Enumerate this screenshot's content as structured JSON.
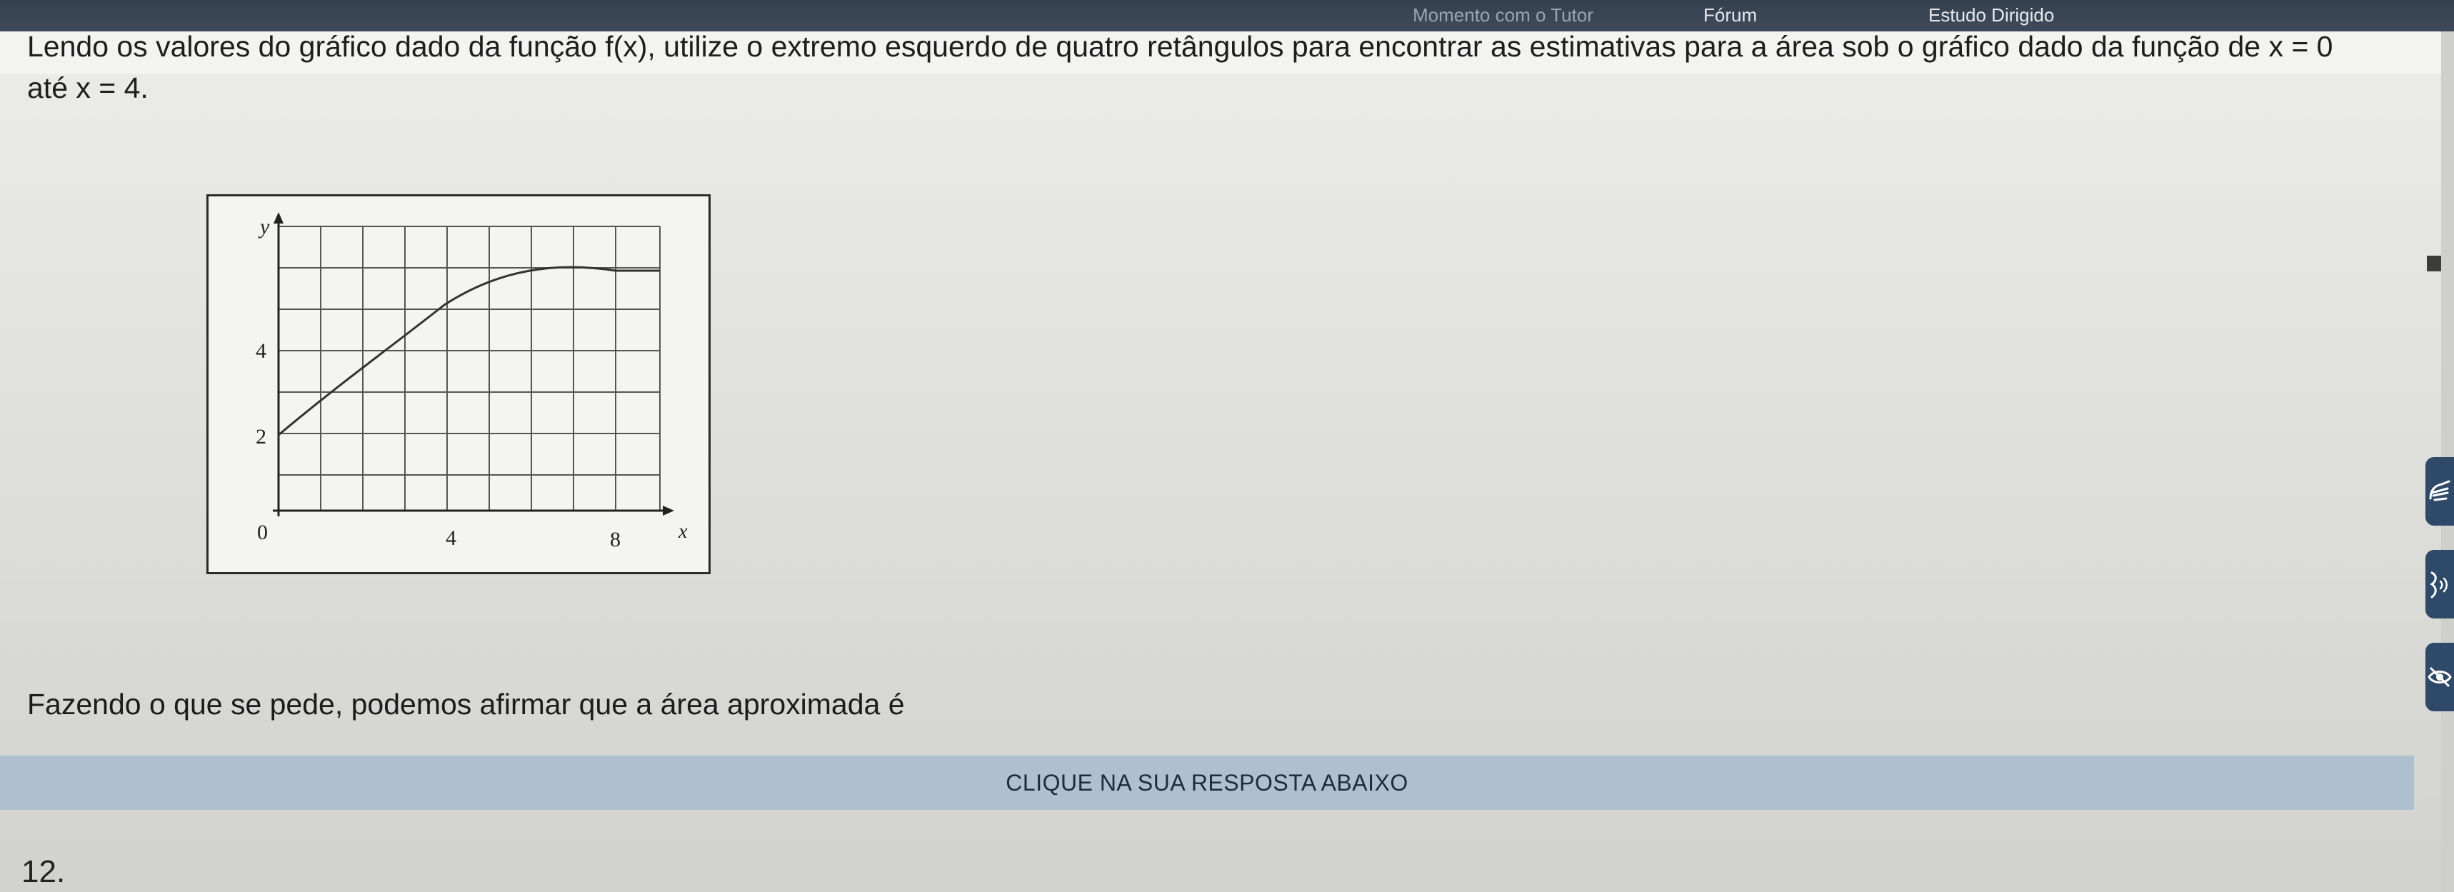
{
  "nav": {
    "item_tutor": "Momento com o Tutor",
    "item_forum": "Fórum",
    "item_study": "Estudo Dirigido"
  },
  "question": {
    "line1": "Lendo os valores do gráfico dado da função f(x), utilize o extremo esquerdo de quatro retângulos para encontrar as estimativas para a área sob o gráfico dado da função de x = 0",
    "line2": "até x = 4.",
    "prompt": "Fazendo o que se pede, podemos afirmar que a área aproximada é"
  },
  "graph": {
    "y_axis_label": "y",
    "x_axis_label": "x",
    "origin_label": "0",
    "y_ticks": [
      "2",
      "4"
    ],
    "x_ticks": [
      "4",
      "8"
    ]
  },
  "answer": {
    "banner": "CLIQUE NA SUA RESPOSTA ABAIXO",
    "first_option_number": "12."
  },
  "side_tools": {
    "icons": [
      "sign-language-icon",
      "audio-reader-icon",
      "hide-content-icon"
    ],
    "accent": "#2f4a68"
  },
  "colors": {
    "topbar": "#3a4556",
    "answer_bar": "#aebfd0",
    "page_bg": "#e2e2df"
  }
}
